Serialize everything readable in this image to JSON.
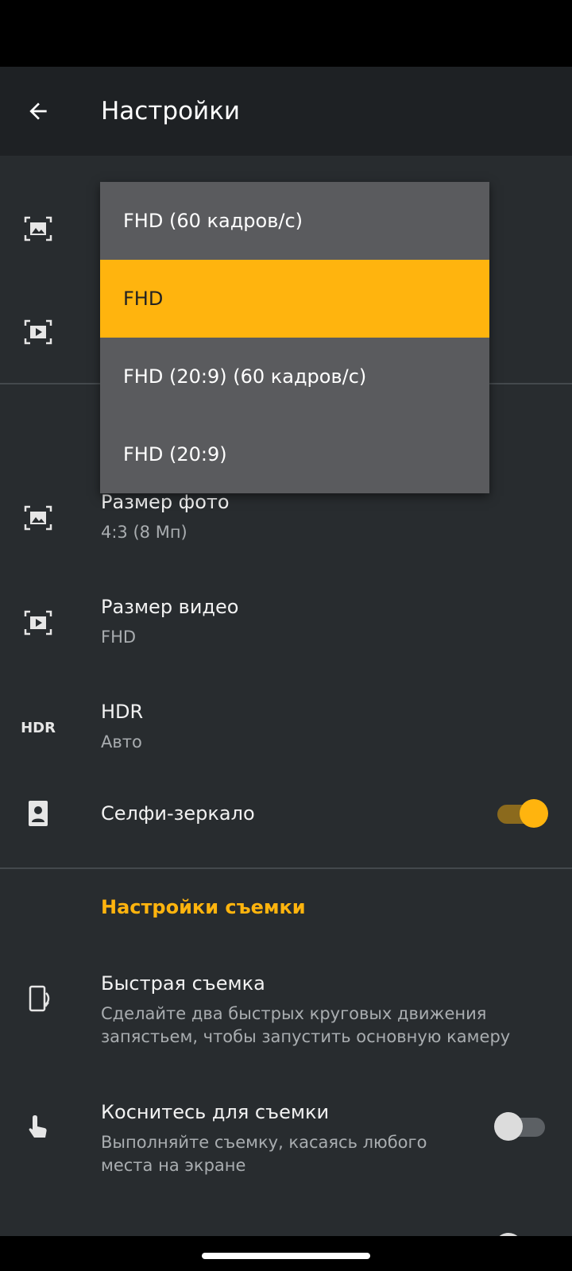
{
  "app_bar": {
    "title": "Настройки",
    "back_icon": "arrow-left-icon"
  },
  "dropdown": {
    "options": [
      {
        "label": "FHD (60 кадров/с)",
        "selected": false
      },
      {
        "label": "FHD",
        "selected": true
      },
      {
        "label": "FHD (20:9) (60 кадров/с)",
        "selected": false
      },
      {
        "label": "FHD (20:9)",
        "selected": false
      }
    ]
  },
  "settings": {
    "photo_size": {
      "title": "Размер фото",
      "value": "4:3 (8 Мп)",
      "icon": "photo-size-icon"
    },
    "video_size": {
      "title": "Размер видео",
      "value": "FHD",
      "icon": "video-size-icon"
    },
    "hdr": {
      "title": "HDR",
      "value": "Авто",
      "icon_text": "HDR"
    },
    "selfie_mirror": {
      "title": "Селфи-зеркало",
      "enabled": true,
      "icon": "portrait-icon"
    }
  },
  "shooting_section": {
    "header": "Настройки съемки",
    "quick_capture": {
      "title": "Быстрая съемка",
      "description": "Сделайте два быстрых круговых движения запястьем, чтобы запустить основную камеру",
      "icon": "phone-rotate-icon"
    },
    "touch_capture": {
      "title": "Коснитесь для съемки",
      "description": "Выполняйте съемку, касаясь любого места на экране",
      "enabled": false,
      "icon": "touch-icon"
    }
  },
  "colors": {
    "accent": "#ffb40e",
    "background": "#282c2f",
    "app_bar": "#1e2124",
    "menu": "#5a5b5e"
  }
}
